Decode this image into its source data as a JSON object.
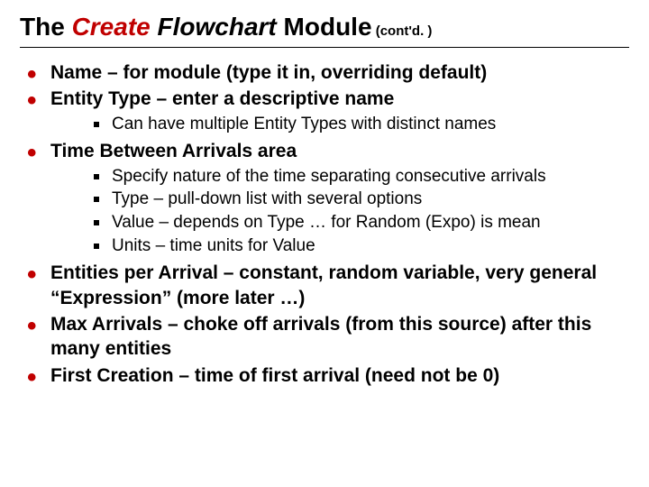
{
  "title": {
    "prefix": "The ",
    "create": "Create",
    "flowchart": " Flowchart ",
    "module": "Module",
    "contd": " (cont'd. )"
  },
  "bullets": [
    {
      "text": "Name – for module (type it in, overriding default)",
      "sub": []
    },
    {
      "text": "Entity Type – enter a descriptive name",
      "sub": [
        "Can have multiple Entity Types with distinct names"
      ]
    },
    {
      "text": "Time Between Arrivals area",
      "sub": [
        "Specify nature of the time separating consecutive arrivals",
        "Type – pull-down list with several options",
        "Value – depends on Type … for Random (Expo) is mean",
        "Units – time units for Value"
      ]
    },
    {
      "text": "Entities per Arrival – constant, random variable, very general “Expression” (more later …)",
      "sub": []
    },
    {
      "text": "Max Arrivals – choke off arrivals (from this source) after this many entities",
      "sub": []
    },
    {
      "text": "First Creation – time of first arrival (need not be 0)",
      "sub": []
    }
  ]
}
